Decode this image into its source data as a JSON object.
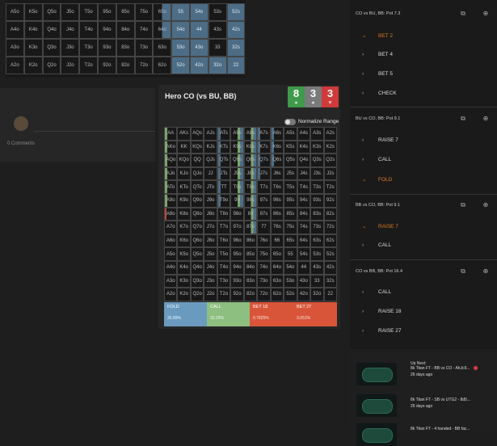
{
  "top_grid": {
    "rows": [
      [
        "A5o",
        "K5o",
        "Q5o",
        "J5o",
        "T5o",
        "95o",
        "85o",
        "75o",
        "65o",
        "55",
        "54s",
        "53s",
        "52s"
      ],
      [
        "A4o",
        "K4o",
        "Q4o",
        "J4o",
        "T4o",
        "94o",
        "84o",
        "74o",
        "64o",
        "54o",
        "44",
        "43s",
        "42s"
      ],
      [
        "A3o",
        "K3o",
        "Q3o",
        "J3o",
        "T3o",
        "93o",
        "83o",
        "73o",
        "63o",
        "53o",
        "43o",
        "33",
        "32s"
      ],
      [
        "A2o",
        "K2o",
        "Q2o",
        "J2o",
        "T2o",
        "92o",
        "82o",
        "72o",
        "62o",
        "52o",
        "42o",
        "32o",
        "22"
      ]
    ]
  },
  "left_panel": {
    "comments": "0 Comments"
  },
  "hero": {
    "title": "Hero CO (vs BU, BB)",
    "badges": [
      {
        "value": "8",
        "color": "#3f9a4b"
      },
      {
        "value": "3",
        "color": "#7a7a7a"
      },
      {
        "value": "3",
        "color": "#cf3a3a"
      }
    ],
    "normalize_label": "Normalize Range",
    "summary": [
      {
        "label": "FOLD",
        "pct": "35.89%",
        "color": "#6a9bbf"
      },
      {
        "label": "CALL",
        "pct": "32.29%",
        "color": "#8dbf80"
      },
      {
        "label": "BET 18",
        "pct": "0.7825%",
        "color": "#d9553a"
      },
      {
        "label": "BET 27",
        "pct": "3.051%",
        "color": "#d9553a"
      }
    ]
  },
  "hero_grid": {
    "rows": [
      [
        "AA",
        "AKs",
        "AQs",
        "AJs",
        "ATs",
        "A9s",
        "A8s",
        "A7s",
        "A6s",
        "A5s",
        "A4s",
        "A3s",
        "A2s"
      ],
      [
        "AKo",
        "KK",
        "KQs",
        "KJs",
        "KTs",
        "K9s",
        "K8s",
        "K7s",
        "K6s",
        "K5s",
        "K4s",
        "K3s",
        "K2s"
      ],
      [
        "AQo",
        "KQo",
        "QQ",
        "QJs",
        "QTs",
        "Q9s",
        "Q8s",
        "Q7s",
        "Q6s",
        "Q5s",
        "Q4s",
        "Q3s",
        "Q2s"
      ],
      [
        "AJo",
        "KJo",
        "QJo",
        "JJ",
        "JTs",
        "J9s",
        "J8s",
        "J7s",
        "J6s",
        "J5s",
        "J4s",
        "J3s",
        "J2s"
      ],
      [
        "ATo",
        "KTo",
        "QTo",
        "JTo",
        "TT",
        "T9s",
        "T8s",
        "T7s",
        "T6s",
        "T5s",
        "T4s",
        "T3s",
        "T2s"
      ],
      [
        "A9o",
        "K9o",
        "Q9o",
        "J9o",
        "T9o",
        "99",
        "98s",
        "97s",
        "96s",
        "95s",
        "94s",
        "93s",
        "92s"
      ],
      [
        "A8o",
        "K8o",
        "Q8o",
        "J8o",
        "T8o",
        "98o",
        "88",
        "87s",
        "86s",
        "85s",
        "84s",
        "83s",
        "82s"
      ],
      [
        "A7o",
        "K7o",
        "Q7o",
        "J7o",
        "T7o",
        "97o",
        "87o",
        "77",
        "76s",
        "75s",
        "74s",
        "73s",
        "72s"
      ],
      [
        "A6o",
        "K6o",
        "Q6o",
        "J6o",
        "T6o",
        "96o",
        "86o",
        "76o",
        "66",
        "65s",
        "64s",
        "63s",
        "62s"
      ],
      [
        "A5o",
        "K5o",
        "Q5o",
        "J5o",
        "T5o",
        "95o",
        "85o",
        "75o",
        "65o",
        "55",
        "54s",
        "53s",
        "52s"
      ],
      [
        "A4o",
        "K4o",
        "Q4o",
        "J4o",
        "T4o",
        "94o",
        "84o",
        "74o",
        "64o",
        "54o",
        "44",
        "43s",
        "42s"
      ],
      [
        "A3o",
        "K3o",
        "Q3o",
        "J3o",
        "T3o",
        "93o",
        "83o",
        "73o",
        "63o",
        "53o",
        "43o",
        "33",
        "32s"
      ],
      [
        "A2o",
        "K2o",
        "Q2o",
        "J2o",
        "T2o",
        "92o",
        "82o",
        "72o",
        "62o",
        "52o",
        "42o",
        "32o",
        "22"
      ]
    ]
  },
  "actions": [
    {
      "title": "CO vs BU, BB: Pot 7.3",
      "options": [
        {
          "label": "BET 2",
          "active": true
        },
        {
          "label": "BET 4",
          "active": false
        },
        {
          "label": "BET 5",
          "active": false
        },
        {
          "label": "CHECK",
          "active": false
        }
      ]
    },
    {
      "title": "BU vs CO, BB: Pot 9.1",
      "options": [
        {
          "label": "RAISE 7",
          "active": false
        },
        {
          "label": "CALL",
          "active": false
        },
        {
          "label": "FOLD",
          "active": true
        }
      ]
    },
    {
      "title": "BB vs CO, BB: Pot 9.1",
      "options": [
        {
          "label": "RAISE 7",
          "active": true
        },
        {
          "label": "CALL",
          "active": false
        }
      ]
    },
    {
      "title": "CO vs BB, BB: Pot 16.4",
      "options": [
        {
          "label": "CALL",
          "active": false
        },
        {
          "label": "RAISE 18",
          "active": false
        },
        {
          "label": "RAISE 27",
          "active": false
        }
      ]
    }
  ],
  "videos": {
    "up_next": "Up Next:",
    "items": [
      {
        "title": "8k Titan FT - BB vs CO - AhJc9...",
        "age": "26 days ago"
      },
      {
        "title": "8k Titan FT - SB vs UTG2 - 8d5...",
        "age": "26 days ago"
      },
      {
        "title": "8k Titan FT - 4 handed - BB fac...",
        "age": ""
      }
    ]
  },
  "icons": {
    "copy": "copy-icon",
    "add": "add-circle-icon",
    "chevron_right": "chevron-right-icon",
    "chevron_down": "chevron-down-icon"
  }
}
